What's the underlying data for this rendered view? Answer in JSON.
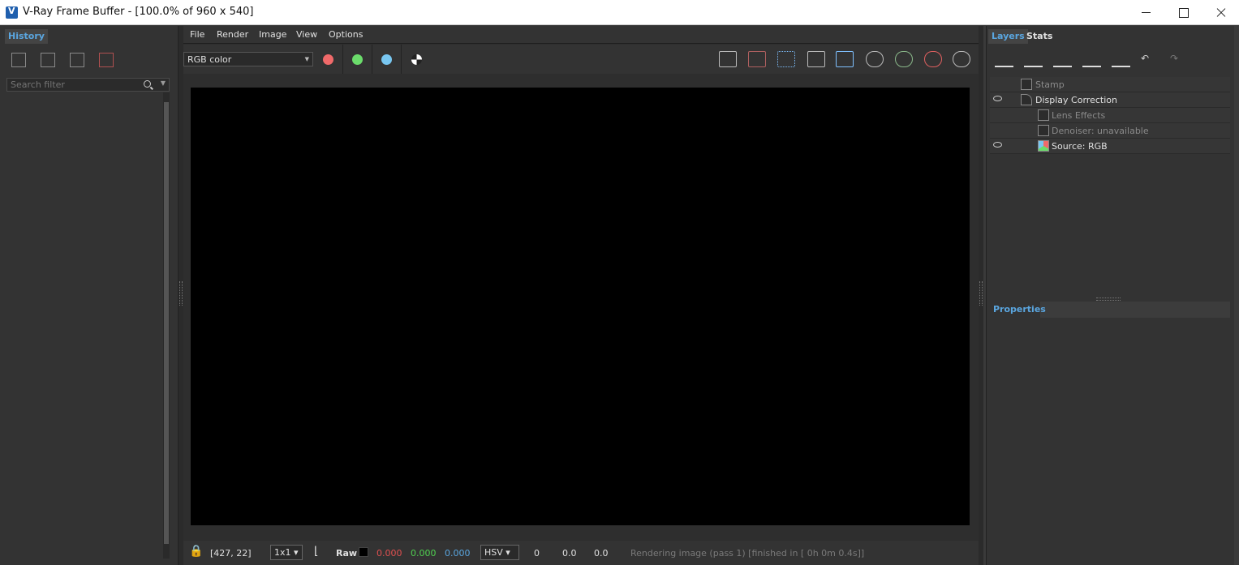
{
  "window": {
    "title": "V-Ray Frame Buffer - [100.0% of 960 x 540]"
  },
  "history": {
    "tab": "History",
    "search_placeholder": "Search filter"
  },
  "menu": [
    "File",
    "Render",
    "Image",
    "View",
    "Options"
  ],
  "toolbar": {
    "channel": "RGB color",
    "colors": {
      "red": "#f06a6a",
      "green": "#6bdc6b",
      "blue": "#78c6f0"
    }
  },
  "status": {
    "coords": "[427, 22]",
    "ratio": "1x1",
    "raw_label": "Raw",
    "r": "0.000",
    "g": "0.000",
    "b": "0.000",
    "color_mode": "HSV",
    "h": "0",
    "s": "0.0",
    "v": "0.0",
    "message": "Rendering image (pass 1) [finished in [ 0h  0m  0.4s]]"
  },
  "right": {
    "tab_layers": "Layers",
    "tab_stats": "Stats",
    "layers": [
      {
        "label": "Stamp",
        "visible": false
      },
      {
        "label": "Display Correction",
        "visible": true
      },
      {
        "label": "Lens Effects",
        "visible": false
      },
      {
        "label": "Denoiser: unavailable",
        "visible": false
      },
      {
        "label": "Source: RGB",
        "visible": true
      }
    ],
    "properties_tab": "Properties"
  }
}
